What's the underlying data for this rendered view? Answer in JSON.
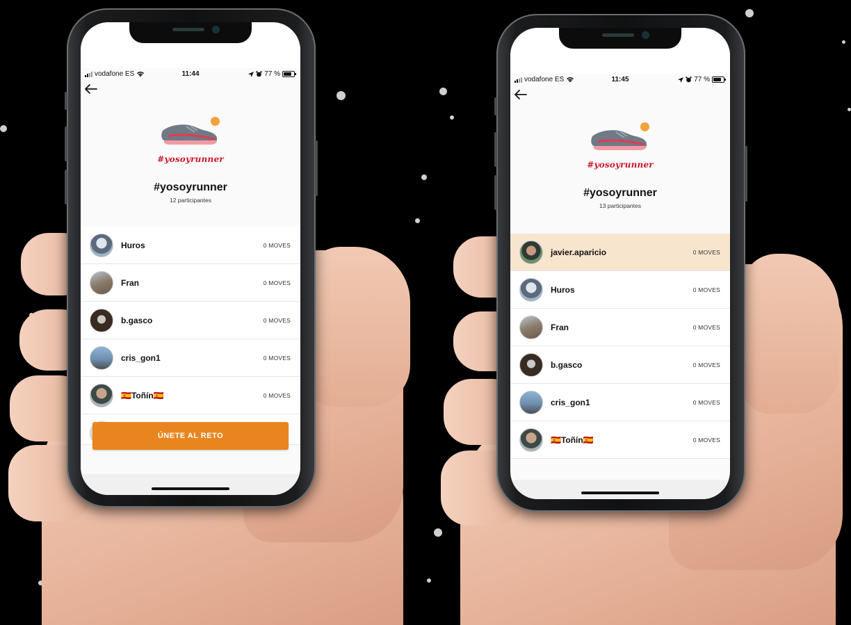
{
  "phones": [
    {
      "status": {
        "carrier": "vodafone ES",
        "time": "11:44",
        "battery": "77 %",
        "battery_level": 0.77
      },
      "challenge": {
        "logo_text": "#yosoyrunner",
        "title": "#yosoyrunner",
        "participants": "12 participantes"
      },
      "participants": [
        {
          "name": "Huros",
          "moves": "0 MOVES",
          "highlight": false
        },
        {
          "name": "Fran",
          "moves": "0 MOVES",
          "highlight": false
        },
        {
          "name": "b.gasco",
          "moves": "0 MOVES",
          "highlight": false
        },
        {
          "name": "cris_gon1",
          "moves": "0 MOVES",
          "highlight": false
        },
        {
          "name": "🇪🇸Toñín🇪🇸",
          "moves": "0 MOVES",
          "highlight": false
        }
      ],
      "join_button": "ÚNETE AL RETO"
    },
    {
      "status": {
        "carrier": "vodafone ES",
        "time": "11:45",
        "battery": "77 %",
        "battery_level": 0.77
      },
      "challenge": {
        "logo_text": "#yosoyrunner",
        "title": "#yosoyrunner",
        "participants": "13 participantes"
      },
      "participants": [
        {
          "name": "javier.aparicio",
          "moves": "0 MOVES",
          "highlight": true
        },
        {
          "name": "Huros",
          "moves": "0 MOVES",
          "highlight": false
        },
        {
          "name": "Fran",
          "moves": "0 MOVES",
          "highlight": false
        },
        {
          "name": "b.gasco",
          "moves": "0 MOVES",
          "highlight": false
        },
        {
          "name": "cris_gon1",
          "moves": "0 MOVES",
          "highlight": false
        },
        {
          "name": "🇪🇸Toñín🇪🇸",
          "moves": "0 MOVES",
          "highlight": false
        }
      ]
    }
  ],
  "icons": {
    "back": "arrow-left-icon",
    "signal": "cellular-signal-icon",
    "wifi": "wifi-icon",
    "location": "location-arrow-icon",
    "alarm": "alarm-icon",
    "battery": "battery-icon",
    "shoe": "running-shoe-icon"
  },
  "colors": {
    "accent_orange": "#e9851f",
    "highlight_row": "#f8e5cd",
    "hashtag_red": "#c8182a",
    "background": "#000000"
  }
}
